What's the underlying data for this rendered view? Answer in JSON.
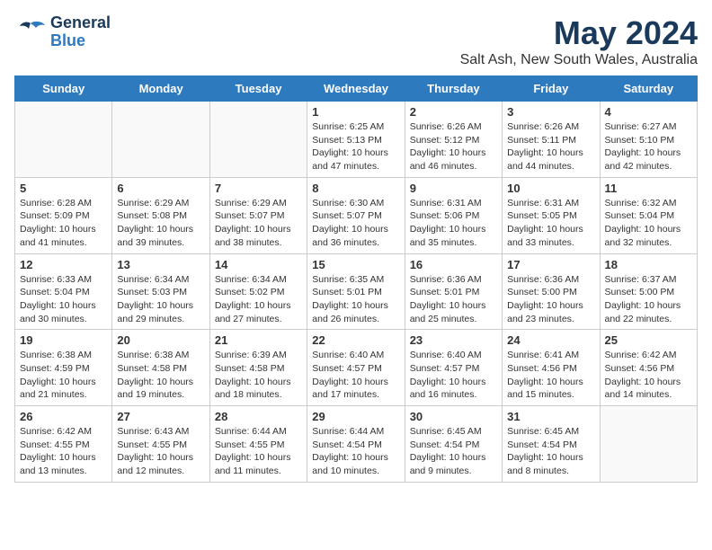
{
  "header": {
    "logo_general": "General",
    "logo_blue": "Blue",
    "title": "May 2024",
    "subtitle": "Salt Ash, New South Wales, Australia"
  },
  "calendar": {
    "days_of_week": [
      "Sunday",
      "Monday",
      "Tuesday",
      "Wednesday",
      "Thursday",
      "Friday",
      "Saturday"
    ],
    "weeks": [
      [
        {
          "day": "",
          "info": ""
        },
        {
          "day": "",
          "info": ""
        },
        {
          "day": "",
          "info": ""
        },
        {
          "day": "1",
          "info": "Sunrise: 6:25 AM\nSunset: 5:13 PM\nDaylight: 10 hours and 47 minutes."
        },
        {
          "day": "2",
          "info": "Sunrise: 6:26 AM\nSunset: 5:12 PM\nDaylight: 10 hours and 46 minutes."
        },
        {
          "day": "3",
          "info": "Sunrise: 6:26 AM\nSunset: 5:11 PM\nDaylight: 10 hours and 44 minutes."
        },
        {
          "day": "4",
          "info": "Sunrise: 6:27 AM\nSunset: 5:10 PM\nDaylight: 10 hours and 42 minutes."
        }
      ],
      [
        {
          "day": "5",
          "info": "Sunrise: 6:28 AM\nSunset: 5:09 PM\nDaylight: 10 hours and 41 minutes."
        },
        {
          "day": "6",
          "info": "Sunrise: 6:29 AM\nSunset: 5:08 PM\nDaylight: 10 hours and 39 minutes."
        },
        {
          "day": "7",
          "info": "Sunrise: 6:29 AM\nSunset: 5:07 PM\nDaylight: 10 hours and 38 minutes."
        },
        {
          "day": "8",
          "info": "Sunrise: 6:30 AM\nSunset: 5:07 PM\nDaylight: 10 hours and 36 minutes."
        },
        {
          "day": "9",
          "info": "Sunrise: 6:31 AM\nSunset: 5:06 PM\nDaylight: 10 hours and 35 minutes."
        },
        {
          "day": "10",
          "info": "Sunrise: 6:31 AM\nSunset: 5:05 PM\nDaylight: 10 hours and 33 minutes."
        },
        {
          "day": "11",
          "info": "Sunrise: 6:32 AM\nSunset: 5:04 PM\nDaylight: 10 hours and 32 minutes."
        }
      ],
      [
        {
          "day": "12",
          "info": "Sunrise: 6:33 AM\nSunset: 5:04 PM\nDaylight: 10 hours and 30 minutes."
        },
        {
          "day": "13",
          "info": "Sunrise: 6:34 AM\nSunset: 5:03 PM\nDaylight: 10 hours and 29 minutes."
        },
        {
          "day": "14",
          "info": "Sunrise: 6:34 AM\nSunset: 5:02 PM\nDaylight: 10 hours and 27 minutes."
        },
        {
          "day": "15",
          "info": "Sunrise: 6:35 AM\nSunset: 5:01 PM\nDaylight: 10 hours and 26 minutes."
        },
        {
          "day": "16",
          "info": "Sunrise: 6:36 AM\nSunset: 5:01 PM\nDaylight: 10 hours and 25 minutes."
        },
        {
          "day": "17",
          "info": "Sunrise: 6:36 AM\nSunset: 5:00 PM\nDaylight: 10 hours and 23 minutes."
        },
        {
          "day": "18",
          "info": "Sunrise: 6:37 AM\nSunset: 5:00 PM\nDaylight: 10 hours and 22 minutes."
        }
      ],
      [
        {
          "day": "19",
          "info": "Sunrise: 6:38 AM\nSunset: 4:59 PM\nDaylight: 10 hours and 21 minutes."
        },
        {
          "day": "20",
          "info": "Sunrise: 6:38 AM\nSunset: 4:58 PM\nDaylight: 10 hours and 19 minutes."
        },
        {
          "day": "21",
          "info": "Sunrise: 6:39 AM\nSunset: 4:58 PM\nDaylight: 10 hours and 18 minutes."
        },
        {
          "day": "22",
          "info": "Sunrise: 6:40 AM\nSunset: 4:57 PM\nDaylight: 10 hours and 17 minutes."
        },
        {
          "day": "23",
          "info": "Sunrise: 6:40 AM\nSunset: 4:57 PM\nDaylight: 10 hours and 16 minutes."
        },
        {
          "day": "24",
          "info": "Sunrise: 6:41 AM\nSunset: 4:56 PM\nDaylight: 10 hours and 15 minutes."
        },
        {
          "day": "25",
          "info": "Sunrise: 6:42 AM\nSunset: 4:56 PM\nDaylight: 10 hours and 14 minutes."
        }
      ],
      [
        {
          "day": "26",
          "info": "Sunrise: 6:42 AM\nSunset: 4:55 PM\nDaylight: 10 hours and 13 minutes."
        },
        {
          "day": "27",
          "info": "Sunrise: 6:43 AM\nSunset: 4:55 PM\nDaylight: 10 hours and 12 minutes."
        },
        {
          "day": "28",
          "info": "Sunrise: 6:44 AM\nSunset: 4:55 PM\nDaylight: 10 hours and 11 minutes."
        },
        {
          "day": "29",
          "info": "Sunrise: 6:44 AM\nSunset: 4:54 PM\nDaylight: 10 hours and 10 minutes."
        },
        {
          "day": "30",
          "info": "Sunrise: 6:45 AM\nSunset: 4:54 PM\nDaylight: 10 hours and 9 minutes."
        },
        {
          "day": "31",
          "info": "Sunrise: 6:45 AM\nSunset: 4:54 PM\nDaylight: 10 hours and 8 minutes."
        },
        {
          "day": "",
          "info": ""
        }
      ]
    ]
  }
}
